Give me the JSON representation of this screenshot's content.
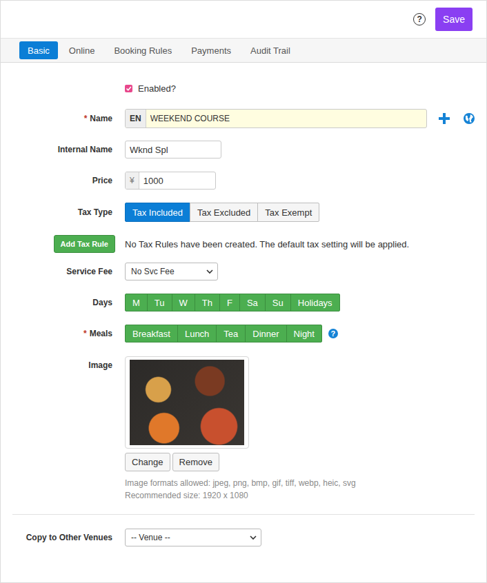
{
  "toolbar": {
    "help_icon": "?",
    "save": "Save"
  },
  "tabs": [
    {
      "label": "Basic",
      "selected": true
    },
    {
      "label": "Online",
      "selected": false
    },
    {
      "label": "Booking Rules",
      "selected": false
    },
    {
      "label": "Payments",
      "selected": false
    },
    {
      "label": "Audit Trail",
      "selected": false
    }
  ],
  "form": {
    "enabled": {
      "label": "Enabled?",
      "checked": true
    },
    "name": {
      "required_mark": "*",
      "label": "Name",
      "lang": "EN",
      "value": "WEEKEND COURSE"
    },
    "internal_name": {
      "label": "Internal Name",
      "value": "Wknd Spl"
    },
    "price": {
      "label": "Price",
      "currency": "¥",
      "value": "1000"
    },
    "tax_type": {
      "label": "Tax Type",
      "options": [
        {
          "label": "Tax Included",
          "selected": true
        },
        {
          "label": "Tax Excluded",
          "selected": false
        },
        {
          "label": "Tax Exempt",
          "selected": false
        }
      ]
    },
    "tax_rule": {
      "button": "Add Tax Rule",
      "message": "No Tax Rules have been created. The default tax setting will be applied."
    },
    "service_fee": {
      "label": "Service Fee",
      "value": "No Svc Fee"
    },
    "days": {
      "label": "Days",
      "options": [
        {
          "label": "M",
          "selected": true
        },
        {
          "label": "Tu",
          "selected": true
        },
        {
          "label": "W",
          "selected": true
        },
        {
          "label": "Th",
          "selected": true
        },
        {
          "label": "F",
          "selected": true
        },
        {
          "label": "Sa",
          "selected": true
        },
        {
          "label": "Su",
          "selected": true
        },
        {
          "label": "Holidays",
          "selected": true
        }
      ]
    },
    "meals": {
      "required_mark": "*",
      "label": "Meals",
      "help_icon": "?",
      "options": [
        {
          "label": "Breakfast",
          "selected": true
        },
        {
          "label": "Lunch",
          "selected": true
        },
        {
          "label": "Tea",
          "selected": true
        },
        {
          "label": "Dinner",
          "selected": true
        },
        {
          "label": "Night",
          "selected": true
        }
      ]
    },
    "image": {
      "label": "Image",
      "buttons": [
        "Change",
        "Remove"
      ],
      "hints": [
        "Image formats allowed: jpeg, png, bmp, gif, tiff, webp, heic, svg",
        "Recommended size: 1920 x 1080"
      ]
    },
    "copy": {
      "label": "Copy to Other Venues",
      "value": "-- Venue --"
    }
  }
}
